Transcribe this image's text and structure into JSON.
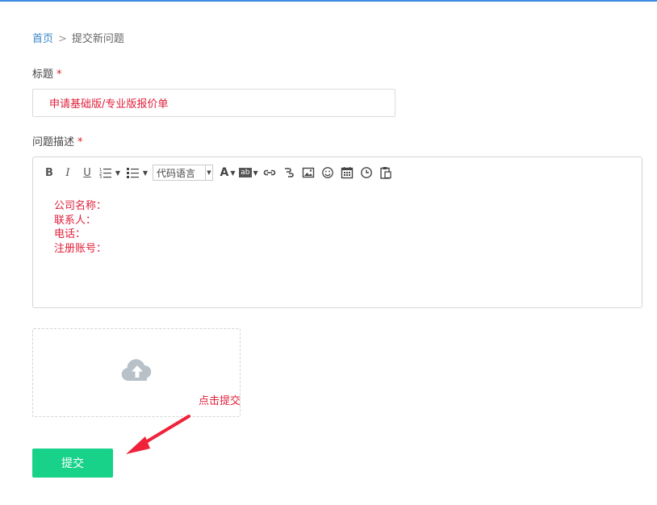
{
  "breadcrumb": {
    "home": "首页",
    "separator": ">",
    "current": "提交新问题"
  },
  "form": {
    "title_label": "标题",
    "desc_label": "问题描述",
    "required_mark": "*",
    "title_value": "申请基础版/专业版报价单",
    "desc_lines": [
      "公司名称：",
      "联系人：",
      "电话：",
      "注册账号："
    ],
    "submit_label": "提交"
  },
  "toolbar": {
    "bold": "B",
    "italic": "I",
    "underline": "U",
    "language_select": "代码语言",
    "font_color_glyph": "A",
    "highlight_glyph": "ab",
    "icons": [
      "ordered-list-icon",
      "unordered-list-icon",
      "font-color-icon",
      "highlight-icon",
      "link-icon",
      "unlink-icon",
      "image-icon",
      "emoji-icon",
      "calendar-icon",
      "clock-icon",
      "paste-icon"
    ]
  },
  "upload": {
    "icon": "cloud-upload-icon"
  },
  "annotation": {
    "text": "点击提交",
    "color": "#e0203a"
  },
  "colors": {
    "accent": "#3b8be0",
    "link": "#3a87c8",
    "submit": "#18d28a",
    "required": "#e02020"
  }
}
